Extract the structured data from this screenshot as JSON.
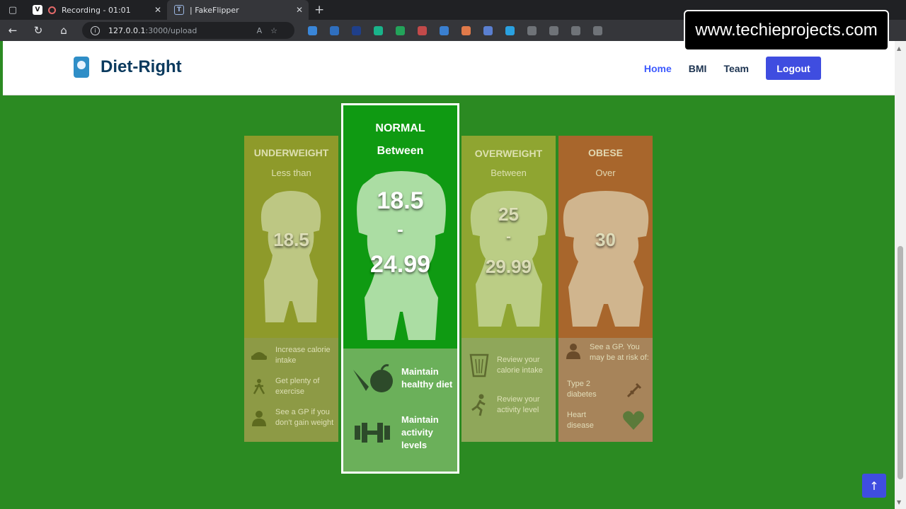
{
  "browser": {
    "tabs": [
      {
        "label": "Recording - 01:01"
      },
      {
        "label": "| FakeFlipper"
      }
    ],
    "url_host": "127.0.0.1",
    "url_path": ":3000/upload"
  },
  "watermark": "www.techieprojects.com",
  "site": {
    "brand": "Diet-Right",
    "nav": {
      "home": "Home",
      "bmi": "BMI",
      "team": "Team",
      "logout": "Logout"
    }
  },
  "cards": {
    "underweight": {
      "title": "UNDERWEIGHT",
      "sub": "Less than",
      "value": "18.5",
      "tips": [
        "Increase calorie intake",
        "Get plenty of exercise",
        "See a GP if you don't gain weight"
      ]
    },
    "normal": {
      "title": "NORMAL",
      "sub": "Between",
      "value_low": "18.5",
      "dash": "-",
      "value_high": "24.99",
      "tips": [
        "Maintain healthy diet",
        "Maintain activity levels"
      ]
    },
    "overweight": {
      "title": "OVERWEIGHT",
      "sub": "Between",
      "value_low": "25",
      "dash": "-",
      "value_high": "29.99",
      "tips": [
        "Review your calorie intake",
        "Review your activity level"
      ]
    },
    "obese": {
      "title": "OBESE",
      "sub": "Over",
      "value": "30",
      "tips": [
        "See a GP. You may be at risk of:",
        "Type 2 diabetes",
        "Heart disease"
      ]
    }
  },
  "colors": {
    "page_bg": "#2b8a22",
    "underweight": "#8e9a2a",
    "normal": "#0f9a12",
    "overweight": "#8fa531",
    "obese": "#a8662c",
    "accent": "#3f4de0"
  }
}
